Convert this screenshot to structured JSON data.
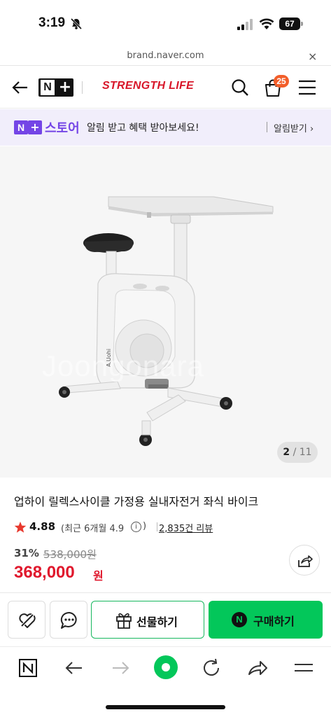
{
  "status_bar": {
    "time": "3:19",
    "battery": "67"
  },
  "url_bar": {
    "url": "brand.naver.com",
    "close": "×"
  },
  "header": {
    "logo_n": "N",
    "logo_plus": "+",
    "brand_name": "STRENGTH LIFE",
    "cart_count": "25"
  },
  "promo": {
    "logo_n": "N",
    "logo_plus": "+",
    "store_label": "스토어",
    "message": "알림 받고 혜택 받아보세요!",
    "cta": "알림받기 ›"
  },
  "gallery": {
    "watermark": "Joongonara",
    "current": "2",
    "slash": "/",
    "total": "11",
    "product_logo": "A.Uohi"
  },
  "product": {
    "title": "업하이 릴렉스사이클 가정용 실내자전거 좌식 바이크",
    "rating": "4.88",
    "recent_rating_prefix": "(최근 6개월 4.9",
    "info_mark": "i",
    "recent_rating_suffix": ")",
    "review_count": "2,835건 리뷰",
    "discount": "31%",
    "original_price": "538,000원",
    "price": "368,000",
    "currency": "원"
  },
  "actions": {
    "gift_label": "선물하기",
    "buy_label": "구매하기",
    "npay_mark": "N"
  },
  "colors": {
    "brand_red": "#d8172a",
    "price_red": "#e0182d",
    "store_purple": "#7445e6",
    "buy_green": "#03c75a",
    "badge_orange": "#f25e2a"
  },
  "icons": [
    "bell-slash-icon",
    "signal-icon",
    "wifi-icon",
    "battery-icon",
    "back-arrow-icon",
    "search-icon",
    "cart-icon",
    "menu-icon",
    "star-icon",
    "share-icon",
    "heart-icon",
    "chat-icon",
    "gift-icon",
    "forward-arrow-icon",
    "refresh-icon",
    "share-arrow-icon"
  ]
}
